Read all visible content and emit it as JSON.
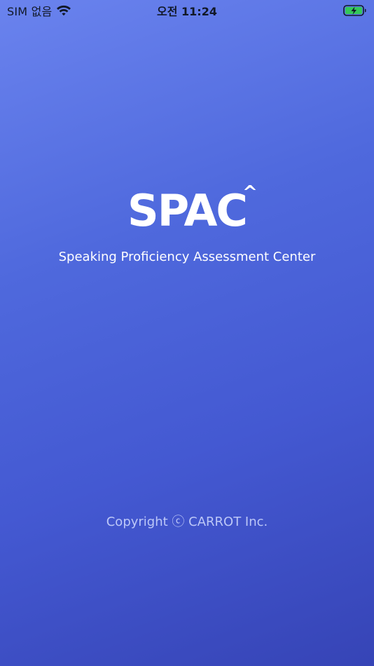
{
  "status_bar": {
    "carrier": "SIM 없음",
    "time": "오전 11:24"
  },
  "icons": {
    "wifi": "wifi-icon",
    "battery": "battery-charging-icon"
  },
  "colors": {
    "gradient_top": "#6a83ee",
    "gradient_bottom": "#3644b6",
    "text": "#ffffff",
    "battery_fill": "#34c759"
  },
  "splash": {
    "logo_text": "SPAC",
    "logo_caret": "^",
    "subtitle": "Speaking Proficiency Assessment Center",
    "copyright": "Copyright ⓒ CARROT Inc."
  }
}
